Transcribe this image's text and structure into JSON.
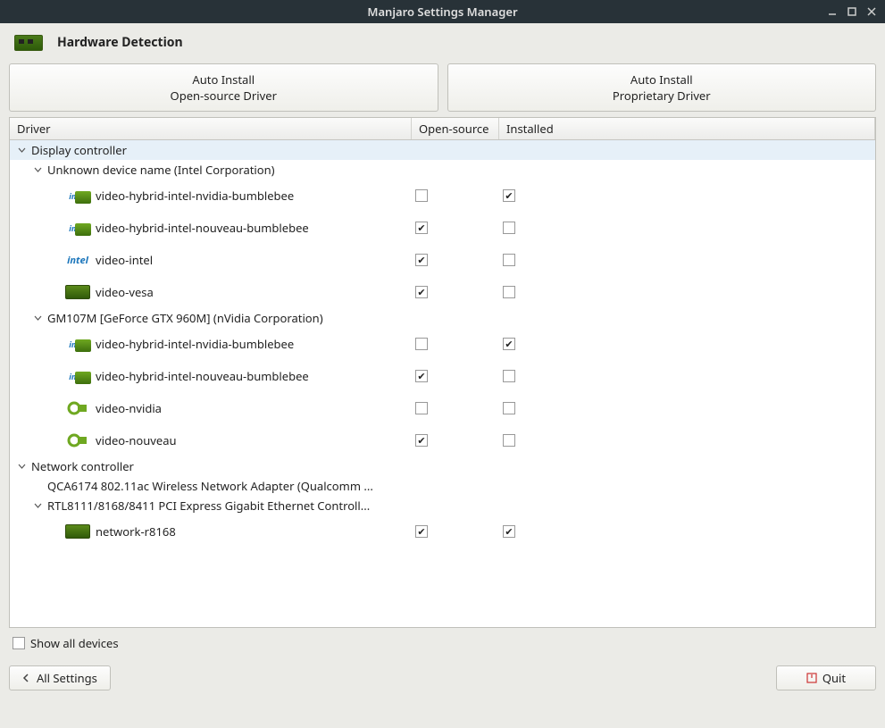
{
  "window": {
    "title": "Manjaro Settings Manager"
  },
  "header": {
    "title": "Hardware Detection"
  },
  "buttons": {
    "auto_open_l1": "Auto Install",
    "auto_open_l2": "Open-source Driver",
    "auto_prop_l1": "Auto Install",
    "auto_prop_l2": "Proprietary Driver"
  },
  "columns": {
    "driver": "Driver",
    "open": "Open-source",
    "installed": "Installed"
  },
  "tree": {
    "display_controller": {
      "label": "Display controller",
      "devices": [
        {
          "label": "Unknown device name (Intel Corporation)",
          "drivers": [
            {
              "name": "video-hybrid-intel-nvidia-bumblebee",
              "open": false,
              "installed": true,
              "icon": "intel-badge"
            },
            {
              "name": "video-hybrid-intel-nouveau-bumblebee",
              "open": true,
              "installed": false,
              "icon": "intel-badge"
            },
            {
              "name": "video-intel",
              "open": true,
              "installed": false,
              "icon": "intel"
            },
            {
              "name": "video-vesa",
              "open": true,
              "installed": false,
              "icon": "pcb"
            }
          ]
        },
        {
          "label": "GM107M [GeForce GTX 960M] (nVidia Corporation)",
          "drivers": [
            {
              "name": "video-hybrid-intel-nvidia-bumblebee",
              "open": false,
              "installed": true,
              "icon": "intel-badge"
            },
            {
              "name": "video-hybrid-intel-nouveau-bumblebee",
              "open": true,
              "installed": false,
              "icon": "intel-badge"
            },
            {
              "name": "video-nvidia",
              "open": false,
              "installed": false,
              "icon": "nvidia"
            },
            {
              "name": "video-nouveau",
              "open": true,
              "installed": false,
              "icon": "nvidia"
            }
          ]
        }
      ]
    },
    "network_controller": {
      "label": "Network controller",
      "devices": [
        {
          "label": "QCA6174 802.11ac Wireless Network Adapter (Qualcomm ...",
          "drivers": []
        },
        {
          "label": "RTL8111/8168/8411 PCI Express Gigabit Ethernet Controll...",
          "drivers": [
            {
              "name": "network-r8168",
              "open": true,
              "installed": true,
              "icon": "pcb"
            }
          ]
        }
      ]
    }
  },
  "show_all": {
    "label": "Show all devices",
    "checked": false
  },
  "footer": {
    "all_settings": "All Settings",
    "quit": "Quit"
  }
}
